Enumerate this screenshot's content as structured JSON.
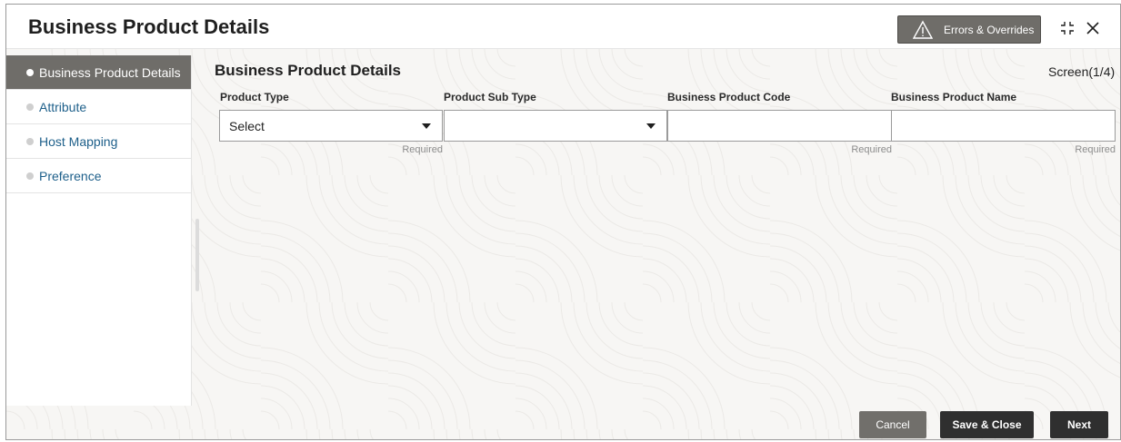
{
  "window": {
    "title": "Business Product Details",
    "errors_button": "Errors & Overrides",
    "icons": {
      "warning": "warning-triangle-icon",
      "resize": "collapse-icon",
      "close": "close-icon"
    }
  },
  "sidebar": {
    "items": [
      {
        "label": "Business Product Details",
        "active": true
      },
      {
        "label": "Attribute",
        "active": false
      },
      {
        "label": "Host Mapping",
        "active": false
      },
      {
        "label": "Preference",
        "active": false
      }
    ]
  },
  "main": {
    "section_title": "Business Product Details",
    "screen_indicator": "Screen(1/4)",
    "fields": [
      {
        "label": "Product Type",
        "value": "Select",
        "type": "select",
        "hint": "Required"
      },
      {
        "label": "Product Sub Type",
        "value": "",
        "type": "select",
        "hint": ""
      },
      {
        "label": "Business Product Code",
        "value": "",
        "type": "text",
        "hint": "Required"
      },
      {
        "label": "Business Product Name",
        "value": "",
        "type": "text",
        "hint": "Required"
      }
    ]
  },
  "footer": {
    "cancel": "Cancel",
    "save_close": "Save & Close",
    "next": "Next"
  },
  "colors": {
    "accent_dark": "#2f2f2f",
    "active_nav": "#6f6d69",
    "link": "#1d5f8a"
  }
}
